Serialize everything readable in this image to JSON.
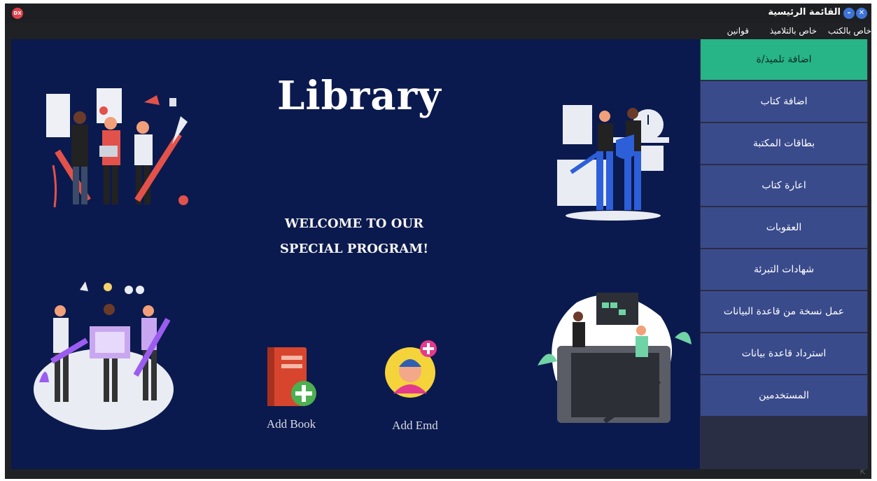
{
  "window": {
    "title": "القائمة الرئيسية",
    "close_badge": "DX"
  },
  "menubar": {
    "items": [
      "خاص بالكتب",
      "خاص بالتلاميذ",
      "قوانين"
    ]
  },
  "main": {
    "title": "Library",
    "welcome_line1": "WELCOME TO OUR",
    "welcome_line2": "SPECIAL PROGRAM!",
    "add_book_label": "Add Book",
    "add_emd_label": "Add Emd"
  },
  "sidebar": {
    "items": [
      {
        "label": "اضافة تلميذ/ة",
        "active": true
      },
      {
        "label": "اضافة كتاب"
      },
      {
        "label": "بطاقات المكتبة"
      },
      {
        "label": "اعارة كتاب"
      },
      {
        "label": "العقوبات"
      },
      {
        "label": "شهادات التبرئة"
      },
      {
        "label": "عمل نسخة من قاعدة البيانات"
      },
      {
        "label": "استرداد قاعدة بيانات"
      },
      {
        "label": "المستخدمين"
      }
    ]
  },
  "colors": {
    "content_bg": "#0b1a4e",
    "nav_btn": "#3a4b8c",
    "nav_active": "#27b487",
    "accent_red": "#e0414b"
  }
}
